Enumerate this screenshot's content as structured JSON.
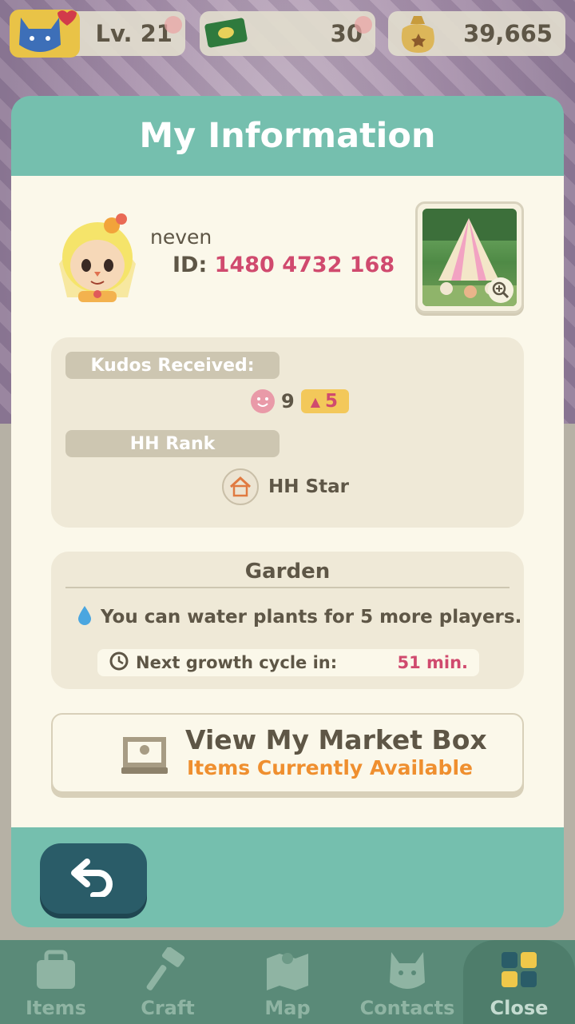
{
  "hud": {
    "level": "Lv. 21",
    "tickets": "30",
    "bells": "39,665"
  },
  "modal": {
    "title": "My Information",
    "profile": {
      "username": "neven",
      "id_label": "ID:",
      "id_value": "1480 4732 168"
    },
    "kudos": {
      "label": "Kudos Received:",
      "count": "9",
      "delta": "5"
    },
    "rank": {
      "label": "HH Rank",
      "value": "HH Star"
    },
    "garden": {
      "title": "Garden",
      "water_text": "You can water plants for 5 more players.",
      "growth_label": "Next growth cycle in:",
      "growth_value": "51 min."
    },
    "market": {
      "title": "View My Market Box",
      "subtitle": "Items Currently Available"
    }
  },
  "nav": {
    "items": [
      {
        "label": "Items",
        "icon": "bag-icon"
      },
      {
        "label": "Craft",
        "icon": "hammer-icon"
      },
      {
        "label": "Map",
        "icon": "map-icon"
      },
      {
        "label": "Contacts",
        "icon": "cat-icon"
      },
      {
        "label": "Close",
        "icon": "grid-icon"
      }
    ]
  },
  "colors": {
    "accent": "#75bfae",
    "highlight": "#d04a6e",
    "orange": "#ef8f2f",
    "text": "#5e5646"
  }
}
